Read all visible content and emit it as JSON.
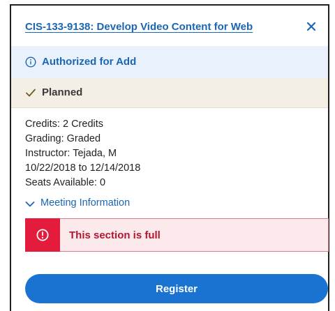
{
  "course": {
    "title": "CIS-133-9138: Develop Video Content for Web"
  },
  "status": {
    "authorized_label": "Authorized for Add",
    "planned_label": "Planned"
  },
  "details": {
    "credits": "Credits: 2 Credits",
    "grading": "Grading: Graded",
    "instructor": "Instructor: Tejada, M",
    "dates": "10/22/2018 to 12/14/2018",
    "seats": "Seats Available:  0"
  },
  "meeting": {
    "label": "Meeting Information"
  },
  "alert": {
    "message": "This section is full"
  },
  "actions": {
    "register_label": "Register"
  },
  "icons": {
    "close": "close-icon",
    "info": "info-icon",
    "check": "check-icon",
    "chevron": "chevron-down-icon",
    "alert": "exclamation-circle-icon"
  },
  "colors": {
    "link_blue": "#1a66b4",
    "button_blue": "#1a73d1",
    "info_bg": "#e9f2fc",
    "planned_bg": "#f4efe4",
    "error_red": "#e31c3d",
    "error_bg": "#fbe9ec"
  }
}
